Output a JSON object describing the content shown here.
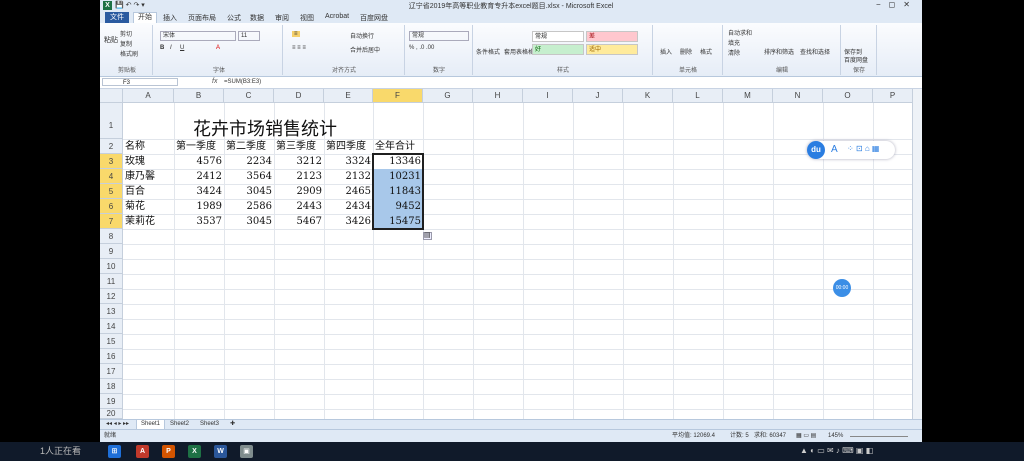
{
  "window": {
    "title": "辽宁省2019年高等职业教育专升本excel题目.xlsx - Microsoft Excel",
    "app_icon": "X"
  },
  "ribbon_tabs": [
    "文件",
    "开始",
    "插入",
    "页面布局",
    "公式",
    "数据",
    "审阅",
    "视图",
    "Acrobat",
    "百度网盘"
  ],
  "ribbon": {
    "clipboard": {
      "cut": "剪切",
      "copy": "复制",
      "paste": "粘贴",
      "format_painter": "格式刷",
      "label": "剪贴板"
    },
    "font": {
      "name": "宋体",
      "size": "11",
      "label": "字体"
    },
    "alignment": {
      "wrap": "自动换行",
      "merge": "合并后居中",
      "label": "对齐方式"
    },
    "number": {
      "format": "常规",
      "label": "数字"
    },
    "styles": {
      "conditional": "条件格式",
      "table": "套用表格格式",
      "normal": "常规",
      "bad": "差",
      "good": "好",
      "neutral": "适中",
      "label": "样式"
    },
    "cells": {
      "insert": "插入",
      "delete": "删除",
      "format": "格式",
      "label": "单元格"
    },
    "editing": {
      "autosum": "自动求和",
      "fill": "填充",
      "clear": "清除",
      "sort": "排序和筛选",
      "find": "查找和选择",
      "label": "编辑"
    },
    "save": {
      "label1": "保存到",
      "label2": "百度网盘",
      "group": "保存"
    }
  },
  "formula_bar": {
    "name_box": "F3",
    "fx": "fx",
    "formula": "=SUM(B3:E3)"
  },
  "sheet": {
    "columns": [
      "A",
      "B",
      "C",
      "D",
      "E",
      "F",
      "G",
      "H",
      "I",
      "J",
      "K",
      "L",
      "M",
      "N",
      "O",
      "P"
    ],
    "rows": [
      "1",
      "2",
      "3",
      "4",
      "5",
      "6",
      "7",
      "8",
      "9",
      "10",
      "11",
      "12",
      "13",
      "14",
      "15",
      "16",
      "17",
      "18",
      "19",
      "20"
    ],
    "title": "花卉市场销售统计",
    "header": [
      "名称",
      "第一季度",
      "第二季度",
      "第三季度",
      "第四季度",
      "全年合计"
    ],
    "data": [
      [
        "玫瑰",
        "4576",
        "2234",
        "3212",
        "3324",
        "13346"
      ],
      [
        "康乃馨",
        "2412",
        "3564",
        "2123",
        "2132",
        "10231"
      ],
      [
        "百合",
        "3424",
        "3045",
        "2909",
        "2465",
        "11843"
      ],
      [
        "菊花",
        "1989",
        "2586",
        "2443",
        "2434",
        "9452"
      ],
      [
        "茉莉花",
        "3537",
        "3045",
        "5467",
        "3426",
        "15475"
      ]
    ]
  },
  "sheet_tabs": [
    "Sheet1",
    "Sheet2",
    "Sheet3"
  ],
  "status": {
    "ready": "就绪",
    "average": "平均值: 12069.4",
    "count": "计数: 5",
    "sum": "求和: 60347",
    "zoom": "145%"
  },
  "float_toolbar": {
    "du": "du",
    "a": "A"
  },
  "blue_dot": "00:00",
  "overlay": "1人正在看"
}
